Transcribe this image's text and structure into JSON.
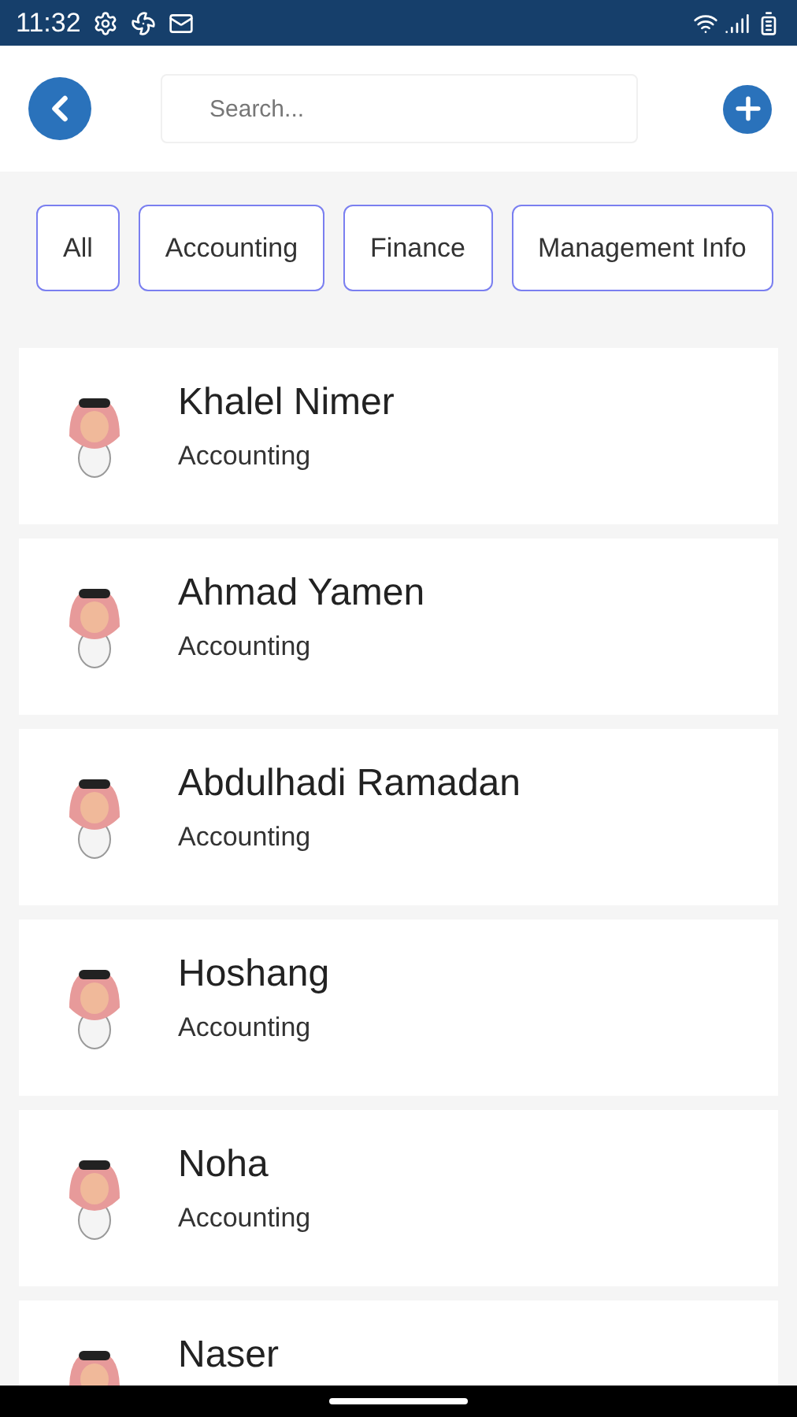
{
  "status_bar": {
    "time": "11:32"
  },
  "search": {
    "placeholder": "Search..."
  },
  "filters": [
    {
      "label": "All"
    },
    {
      "label": "Accounting"
    },
    {
      "label": "Finance"
    },
    {
      "label": "Management Info"
    }
  ],
  "people": [
    {
      "name": "Khalel Nimer",
      "department": "Accounting"
    },
    {
      "name": "Ahmad Yamen",
      "department": "Accounting"
    },
    {
      "name": "Abdulhadi Ramadan",
      "department": "Accounting"
    },
    {
      "name": "Hoshang",
      "department": "Accounting"
    },
    {
      "name": "Noha",
      "department": "Accounting"
    },
    {
      "name": "Naser"
    }
  ]
}
